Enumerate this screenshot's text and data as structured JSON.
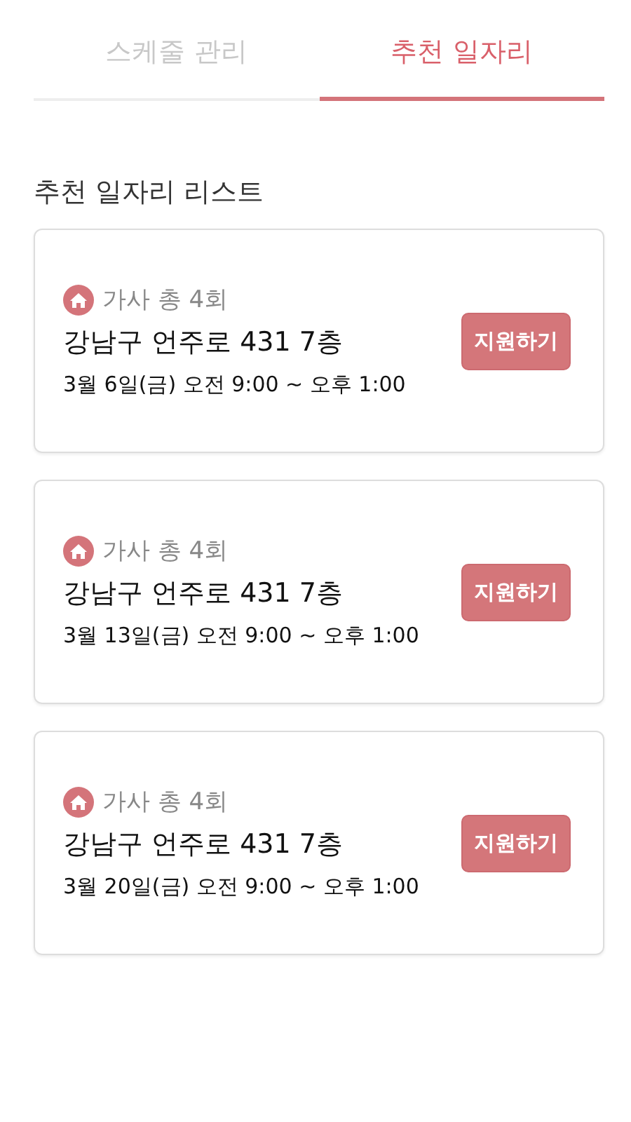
{
  "tabs": [
    {
      "label": "스케줄 관리",
      "selected": false
    },
    {
      "label": "추천 일자리",
      "selected": true
    }
  ],
  "section_title": "추천 일자리 리스트",
  "jobs": [
    {
      "category": "가사 총 4회",
      "address": "강남구 언주로 431 7층",
      "schedule": "3월 6일(금) 오전 9:00 ~ 오후 1:00",
      "apply": "지원하기"
    },
    {
      "category": "가사 총 4회",
      "address": "강남구 언주로 431 7층",
      "schedule": "3월 13일(금) 오전 9:00 ~ 오후 1:00",
      "apply": "지원하기"
    },
    {
      "category": "가사 총 4회",
      "address": "강남구 언주로 431 7층",
      "schedule": "3월 20일(금) 오전 9:00 ~ 오후 1:00",
      "apply": "지원하기"
    }
  ]
}
